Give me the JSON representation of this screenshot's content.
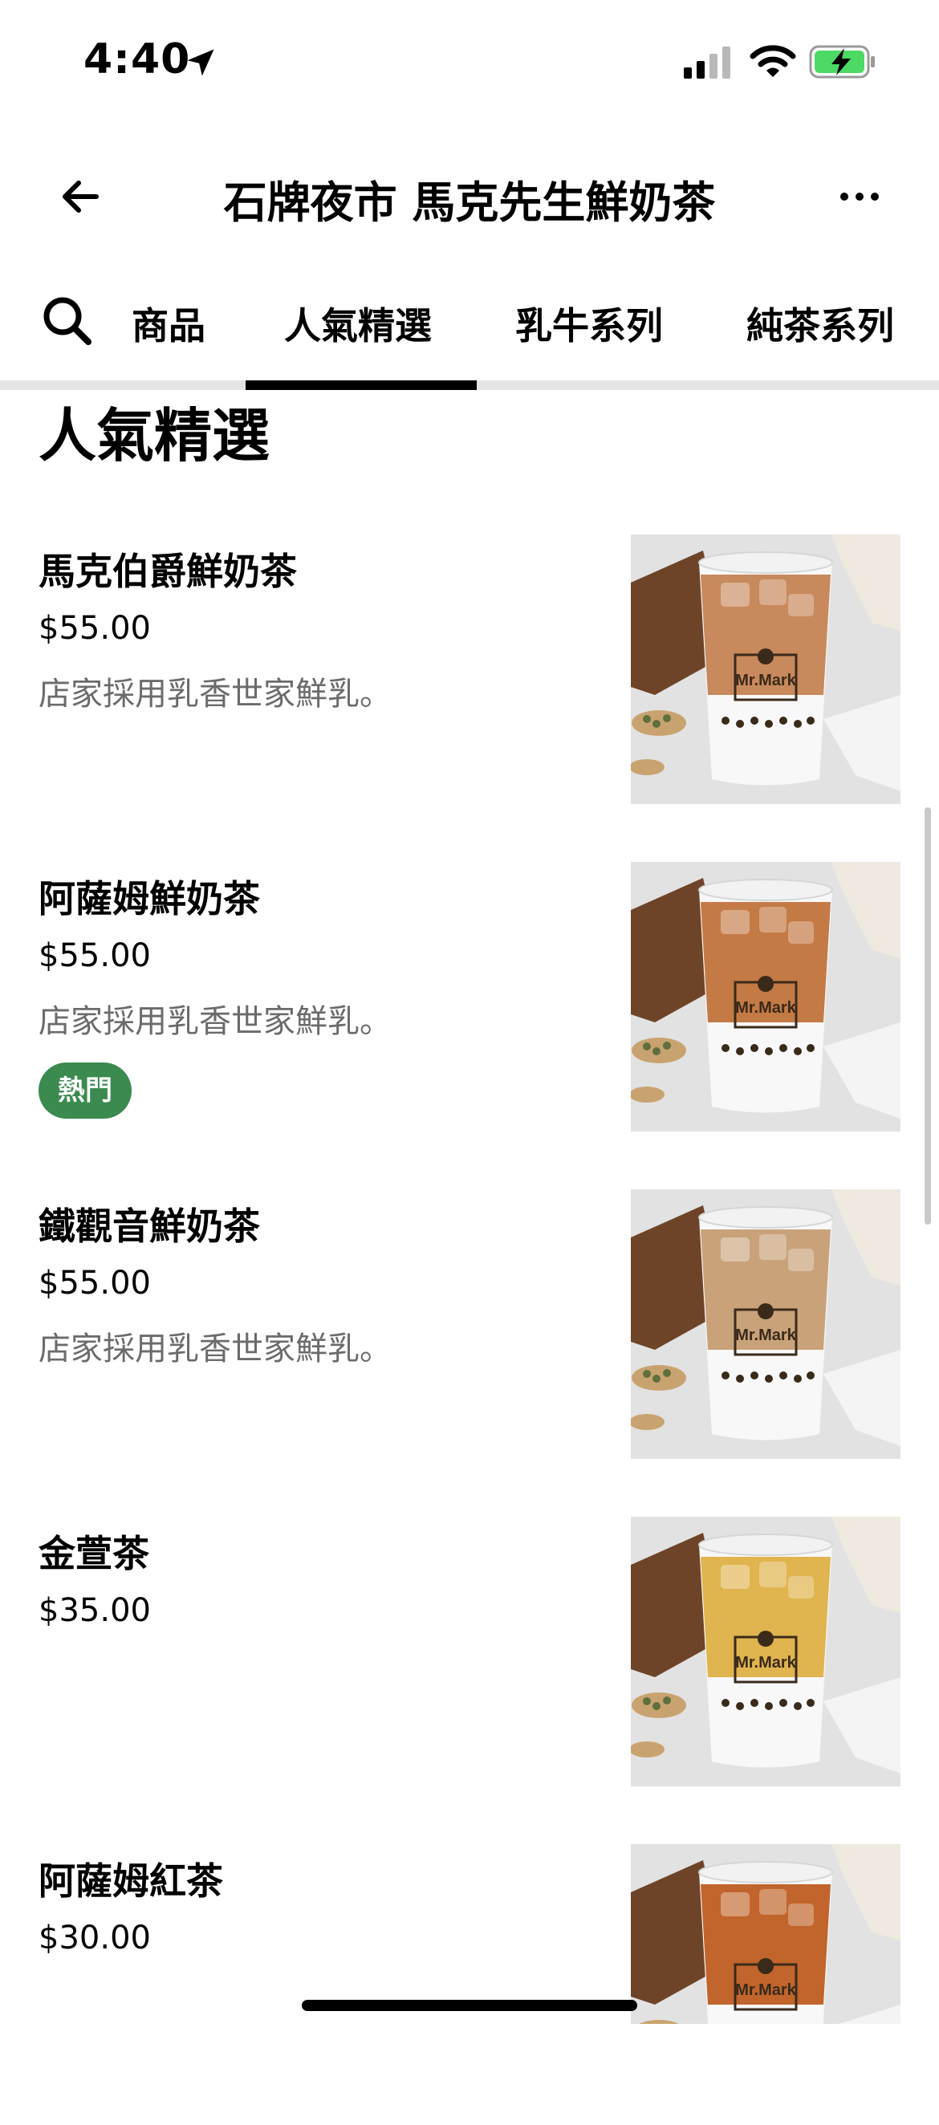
{
  "status_bar": {
    "time": "4:40"
  },
  "nav": {
    "title": "石牌夜市 馬克先生鮮奶茶"
  },
  "tabs": [
    "商品",
    "人氣精選",
    "乳牛系列",
    "純茶系列"
  ],
  "section": {
    "title": "人氣精選"
  },
  "items": [
    {
      "name": "馬克伯爵鮮奶茶",
      "price": "$55.00",
      "description": "店家採用乳香世家鮮乳。",
      "badge": "",
      "tea_color": "#c8895c"
    },
    {
      "name": "阿薩姆鮮奶茶",
      "price": "$55.00",
      "description": "店家採用乳香世家鮮乳。",
      "badge": "熱門",
      "tea_color": "#c47a45"
    },
    {
      "name": "鐵觀音鮮奶茶",
      "price": "$55.00",
      "description": "店家採用乳香世家鮮乳。",
      "badge": "",
      "tea_color": "#c9a27a"
    },
    {
      "name": "金萱茶",
      "price": "$35.00",
      "description": "",
      "badge": "",
      "tea_color": "#e0b44e"
    },
    {
      "name": "阿薩姆紅茶",
      "price": "$30.00",
      "description": "",
      "badge": "",
      "tea_color": "#c1652c"
    }
  ],
  "product_image_logo": "Mr.Mark"
}
